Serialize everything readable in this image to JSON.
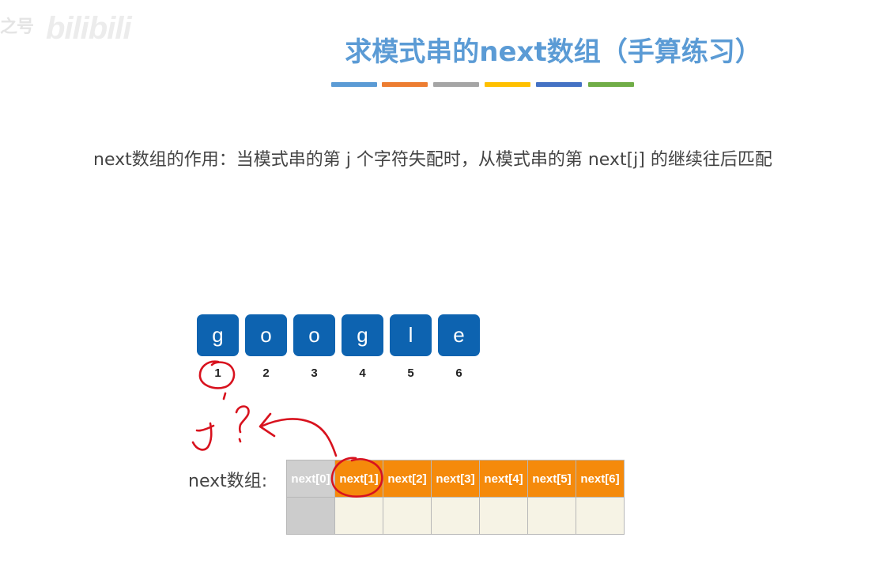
{
  "watermark": {
    "prefix": "之号",
    "text": "bilibili"
  },
  "title": "求模式串的next数组（手算练习）",
  "color_bar": [
    "#5b9bd5",
    "#ed7d31",
    "#a5a5a5",
    "#ffc000",
    "#4472c4",
    "#70ad47"
  ],
  "description": "next数组的作用：当模式串的第 j 个字符失配时，从模式串的第 next[j] 的继续往后匹配",
  "pattern": {
    "chars": [
      "g",
      "o",
      "o",
      "g",
      "l",
      "e"
    ],
    "indices": [
      "1",
      "2",
      "3",
      "4",
      "5",
      "6"
    ]
  },
  "next_array": {
    "label": "next数组:",
    "headers": [
      "next[0]",
      "next[1]",
      "next[2]",
      "next[3]",
      "next[4]",
      "next[5]",
      "next[6]"
    ],
    "values": [
      "",
      "",
      "",
      "",
      "",
      "",
      ""
    ]
  },
  "annotation": {
    "handwritten_j": "J",
    "handwritten_question": "?",
    "ink_color": "#d8121e"
  }
}
